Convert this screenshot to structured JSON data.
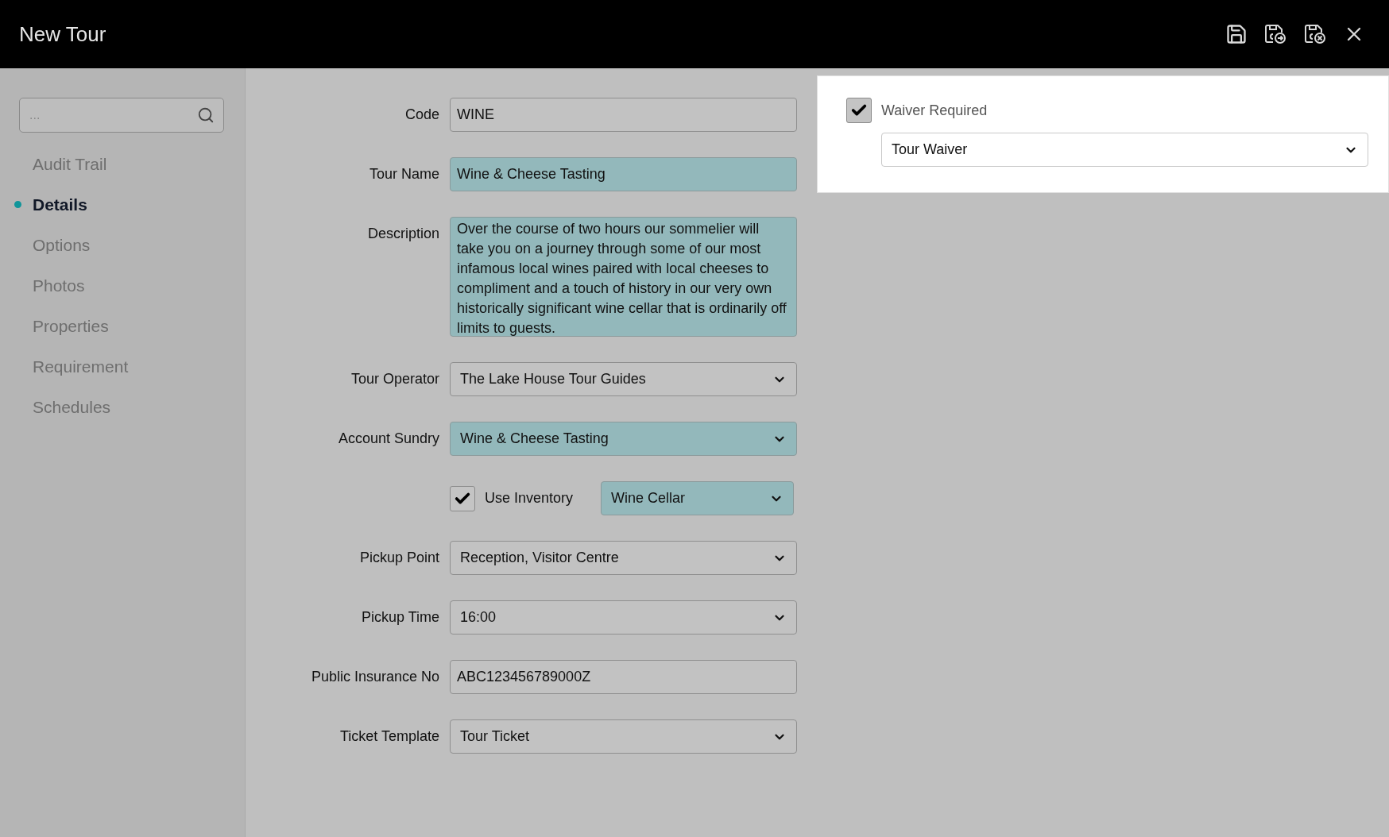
{
  "window": {
    "title": "New Tour"
  },
  "sidebar": {
    "search": {
      "placeholder": "..."
    },
    "items": [
      {
        "label": "Audit Trail",
        "selected": false
      },
      {
        "label": "Details",
        "selected": true
      },
      {
        "label": "Options",
        "selected": false
      },
      {
        "label": "Photos",
        "selected": false
      },
      {
        "label": "Properties",
        "selected": false
      },
      {
        "label": "Requirement",
        "selected": false
      },
      {
        "label": "Schedules",
        "selected": false
      }
    ]
  },
  "form": [
    {
      "kind": "text",
      "label": "Code",
      "value": "WINE",
      "highlighted": false
    },
    {
      "kind": "text",
      "label": "Tour Name",
      "value": "Wine & Cheese Tasting",
      "highlighted": true
    },
    {
      "kind": "textarea",
      "label": "Description",
      "value": "Over the course of two hours our sommelier will take you on a journey through some of our most infamous local wines paired with local cheeses to compliment and a touch of history in our very own historically significant wine cellar that is ordinarily off limits to guests.",
      "highlighted": true
    },
    {
      "kind": "select",
      "label": "Tour Operator",
      "value": "The Lake House Tour Guides",
      "highlighted": false
    },
    {
      "kind": "select",
      "label": "Account Sundry",
      "value": "Wine & Cheese Tasting",
      "highlighted": true
    },
    {
      "kind": "checkselect",
      "checkbox_label": "Use Inventory",
      "checked": true,
      "value": "Wine Cellar",
      "highlighted": true
    },
    {
      "kind": "select",
      "label": "Pickup Point",
      "value": "Reception, Visitor Centre",
      "highlighted": false
    },
    {
      "kind": "select",
      "label": "Pickup Time",
      "value": "16:00",
      "highlighted": false
    },
    {
      "kind": "text",
      "label": "Public Insurance No",
      "value": "ABC123456789000Z",
      "highlighted": false
    },
    {
      "kind": "select",
      "label": "Ticket Template",
      "value": "Tour Ticket",
      "highlighted": false
    }
  ],
  "waiver": {
    "label": "Waiver Required",
    "checked": true,
    "value": "Tour Waiver"
  }
}
